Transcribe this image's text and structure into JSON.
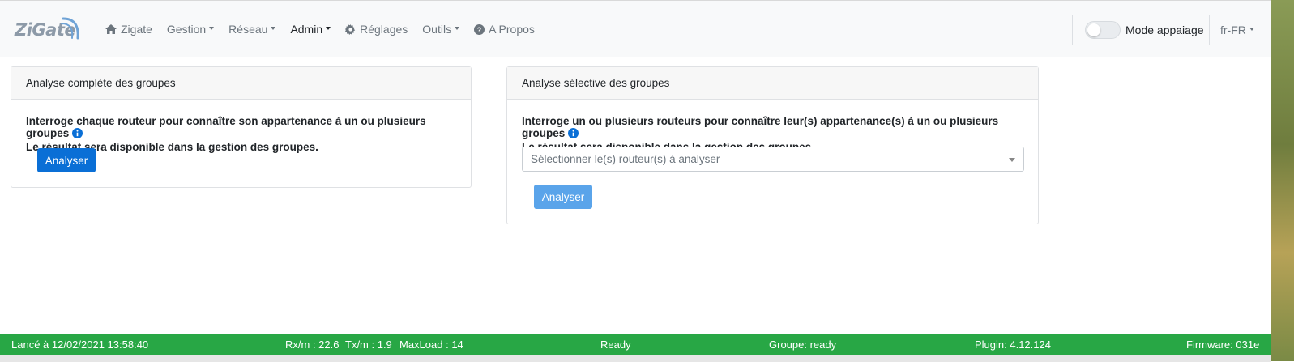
{
  "brand": {
    "logo_text": "ZiGate"
  },
  "nav": {
    "items": [
      {
        "label": "Zigate",
        "icon": "home-icon"
      },
      {
        "label": "Gestion"
      },
      {
        "label": "Réseau"
      },
      {
        "label": "Admin"
      },
      {
        "label": "Réglages",
        "icon": "gear-icon"
      },
      {
        "label": "Outils"
      },
      {
        "label": "A Propos",
        "icon": "question-circle-icon"
      }
    ],
    "pairing_mode_label": "Mode appaiage",
    "pairing_mode_on": false,
    "language": "fr-FR"
  },
  "full_scan": {
    "title": "Analyse complète des groupes",
    "line1": "Interroge chaque routeur pour connaître son appartenance à un ou plusieurs groupes",
    "line2": "Le résultat sera disponible dans la gestion des groupes.",
    "button": "Analyser"
  },
  "selective_scan": {
    "title": "Analyse sélective des groupes",
    "line1": "Interroge un ou plusieurs routeurs pour connaître leur(s) appartenance(s) à un ou plusieurs groupes",
    "line2": "Le résultat sera disponible dans la gestion des groupes.",
    "select_placeholder": "Sélectionner le(s) routeur(s) à analyser",
    "button": "Analyser"
  },
  "status_bar": {
    "started": "Lancé à 12/02/2021 13:58:40",
    "rx": "Rx/m : 22.6",
    "tx": "Tx/m : 1.9",
    "maxload": "MaxLoad : 14",
    "state": "Ready",
    "group": "Groupe: ready",
    "plugin": "Plugin: 4.12.124",
    "firmware": "Firmware: 031e"
  },
  "colors": {
    "primary": "#0a6fd6",
    "primary_disabled": "#5aa4ea",
    "status_bar": "#28a745",
    "info_icon": "#0a6fd6"
  }
}
